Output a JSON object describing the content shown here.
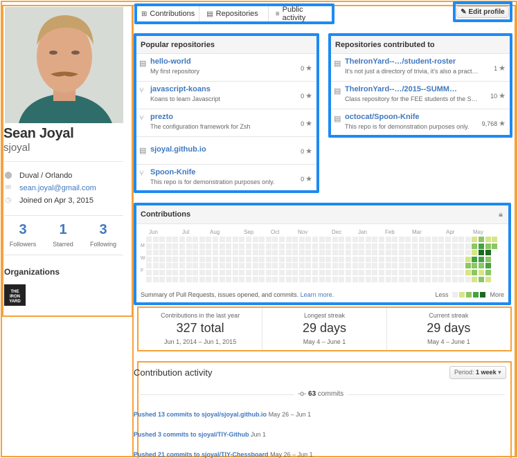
{
  "profile": {
    "name": "Sean Joyal",
    "username": "sjoyal",
    "location": "Duval / Orlando",
    "email": "sean.joyal@gmail.com",
    "joined": "Joined on Apr 3, 2015",
    "stats": [
      {
        "value": "3",
        "label": "Followers"
      },
      {
        "value": "1",
        "label": "Starred"
      },
      {
        "value": "3",
        "label": "Following"
      }
    ],
    "organizations_heading": "Organizations",
    "org_logo_text": "THE IRON YARD"
  },
  "tabs": [
    {
      "label": "Contributions",
      "icon": "contributions-icon"
    },
    {
      "label": "Repositories",
      "icon": "repo-icon"
    },
    {
      "label": "Public activity",
      "icon": "rss-icon"
    }
  ],
  "edit_profile_label": "Edit profile",
  "popular_repos": {
    "title": "Popular repositories",
    "items": [
      {
        "name": "hello-world",
        "desc": "My first repository",
        "stars": "0",
        "fork": false
      },
      {
        "name": "javascript-koans",
        "desc": "Koans to learn Javascript",
        "stars": "0",
        "fork": true
      },
      {
        "name": "prezto",
        "desc": "The configuration framework for Zsh",
        "stars": "0",
        "fork": true
      },
      {
        "name": "sjoyal.github.io",
        "desc": "",
        "stars": "0",
        "fork": false
      },
      {
        "name": "Spoon-Knife",
        "desc": "This repo is for demonstration purposes only.",
        "stars": "0",
        "fork": true
      }
    ]
  },
  "contributed_repos": {
    "title": "Repositories contributed to",
    "items": [
      {
        "name": "TheIronYard--…/student-roster",
        "desc": "It's not just a directory of trivia, it's also a pract…",
        "stars": "1"
      },
      {
        "name": "TheIronYard--…/2015--SUMM…",
        "desc": "Class repository for the FEE students of the S…",
        "stars": "10"
      },
      {
        "name": "octocat/Spoon-Knife",
        "desc": "This repo is for demonstration purposes only.",
        "stars": "9,768"
      }
    ]
  },
  "contributions": {
    "title": "Contributions",
    "months": [
      "Jun",
      "Jul",
      "Aug",
      "Sep",
      "Oct",
      "Nov",
      "Dec",
      "Jan",
      "Feb",
      "Mar",
      "Apr",
      "May"
    ],
    "day_labels": [
      "M",
      "W",
      "F"
    ],
    "summary": "Summary of Pull Requests, issues opened, and commits.",
    "learn_more": "Learn more.",
    "legend_less": "Less",
    "legend_more": "More",
    "colors": [
      "#eeeeee",
      "#d6e685",
      "#8cc665",
      "#44a340",
      "#1e6823"
    ]
  },
  "streaks": [
    {
      "label": "Contributions in the last year",
      "value": "327 total",
      "dates": "Jun 1, 2014 – Jun 1, 2015"
    },
    {
      "label": "Longest streak",
      "value": "29 days",
      "dates": "May 4 – June 1"
    },
    {
      "label": "Current streak",
      "value": "29 days",
      "dates": "May 4 – June 1"
    }
  ],
  "activity": {
    "title": "Contribution activity",
    "period_label": "Period:",
    "period_value": "1 week",
    "commits_count": "63",
    "commits_word": "commits",
    "pushes": [
      {
        "link": "Pushed 13 commits to sjoyal/sjoyal.github.io",
        "dates": "May 26 – Jun 1"
      },
      {
        "link": "Pushed 3 commits to sjoyal/TIY-Github",
        "dates": "Jun 1"
      },
      {
        "link": "Pushed 21 commits to sjoyal/TIY-Chessboard",
        "dates": "May 26 – Jun 1"
      }
    ]
  }
}
